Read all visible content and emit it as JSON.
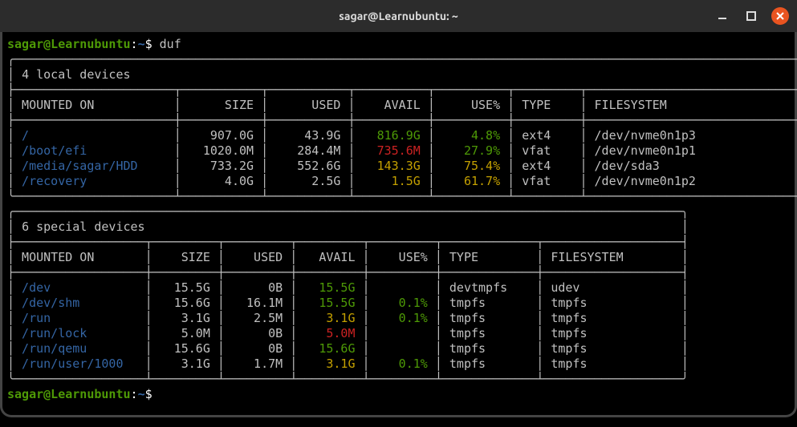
{
  "window": {
    "title": "sagar@Learnubuntu: ~"
  },
  "prompt": {
    "user": "sagar@Learnubuntu",
    "sep1": ":",
    "path": "~",
    "sep2": "$"
  },
  "command": "duf",
  "tables": [
    {
      "title": "4 local devices",
      "columns": [
        "MOUNTED ON",
        "SIZE",
        "USED",
        "AVAIL",
        "USE%",
        "TYPE",
        "FILESYSTEM"
      ],
      "widths": [
        20,
        9,
        9,
        8,
        8,
        7,
        27
      ],
      "rows": [
        {
          "mount": "/",
          "size": "907.0G",
          "used": "43.9G",
          "avail": "816.9G",
          "avail_color": "green",
          "use": "4.8%",
          "use_color": "green",
          "type": "ext4",
          "fs": "/dev/nvme0n1p3"
        },
        {
          "mount": "/boot/efi",
          "size": "1020.0M",
          "used": "284.4M",
          "avail": "735.6M",
          "avail_color": "red",
          "use": "27.9%",
          "use_color": "green",
          "type": "vfat",
          "fs": "/dev/nvme0n1p1"
        },
        {
          "mount": "/media/sagar/HDD",
          "size": "733.2G",
          "used": "552.6G",
          "avail": "143.3G",
          "avail_color": "orange",
          "use": "75.4%",
          "use_color": "yellow",
          "type": "ext4",
          "fs": "/dev/sda3"
        },
        {
          "mount": "/recovery",
          "size": "4.0G",
          "used": "2.5G",
          "avail": "1.5G",
          "avail_color": "orange",
          "use": "61.7%",
          "use_color": "yellow",
          "type": "vfat",
          "fs": "/dev/nvme0n1p2"
        }
      ]
    },
    {
      "title": "6 special devices",
      "columns": [
        "MOUNTED ON",
        "SIZE",
        "USED",
        "AVAIL",
        "USE%",
        "TYPE",
        "FILESYSTEM"
      ],
      "widths": [
        16,
        7,
        7,
        7,
        7,
        11,
        17
      ],
      "rows": [
        {
          "mount": "/dev",
          "size": "15.5G",
          "used": "0B",
          "avail": "15.5G",
          "avail_color": "green",
          "use": "",
          "use_color": "",
          "type": "devtmpfs",
          "fs": "udev"
        },
        {
          "mount": "/dev/shm",
          "size": "15.6G",
          "used": "16.1M",
          "avail": "15.5G",
          "avail_color": "green",
          "use": "0.1%",
          "use_color": "green",
          "type": "tmpfs",
          "fs": "tmpfs"
        },
        {
          "mount": "/run",
          "size": "3.1G",
          "used": "2.5M",
          "avail": "3.1G",
          "avail_color": "orange",
          "use": "0.1%",
          "use_color": "green",
          "type": "tmpfs",
          "fs": "tmpfs"
        },
        {
          "mount": "/run/lock",
          "size": "5.0M",
          "used": "0B",
          "avail": "5.0M",
          "avail_color": "red",
          "use": "",
          "use_color": "",
          "type": "tmpfs",
          "fs": "tmpfs"
        },
        {
          "mount": "/run/qemu",
          "size": "15.6G",
          "used": "0B",
          "avail": "15.6G",
          "avail_color": "green",
          "use": "",
          "use_color": "",
          "type": "tmpfs",
          "fs": "tmpfs"
        },
        {
          "mount": "/run/user/1000",
          "size": "3.1G",
          "used": "1.7M",
          "avail": "3.1G",
          "avail_color": "orange",
          "use": "0.1%",
          "use_color": "green",
          "type": "tmpfs",
          "fs": "tmpfs"
        }
      ]
    }
  ]
}
